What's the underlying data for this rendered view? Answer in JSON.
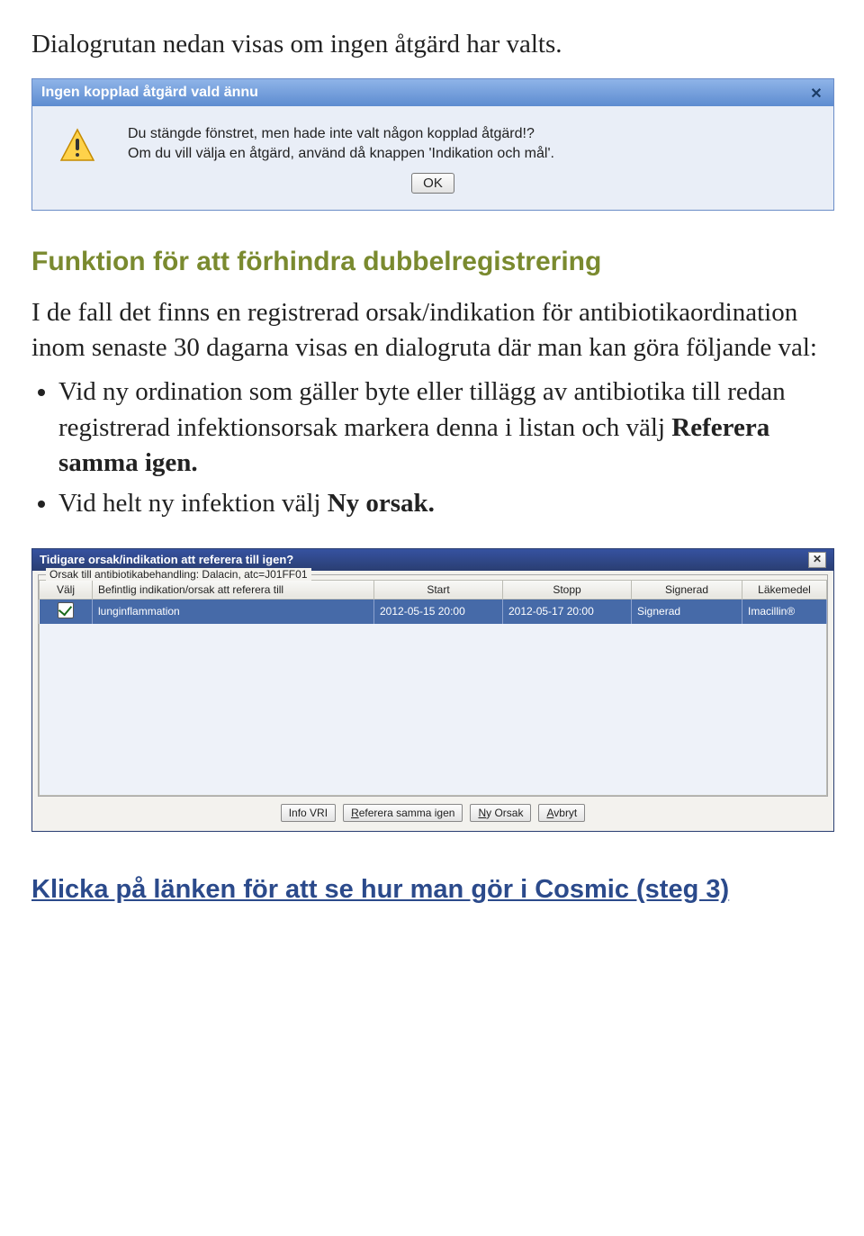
{
  "doc": {
    "intro": "Dialogrutan nedan visas om ingen åtgärd har valts.",
    "heading": "Funktion för att förhindra dubbelregistrering",
    "para": "I de fall det finns en registrerad orsak/indikation för antibiotikaordination inom senaste 30 dagarna visas en dialogruta där man kan göra följande val:",
    "li1_a": "Vid ny ordination som gäller byte eller tillägg av antibiotika till redan registrerad infektionsorsak markera denna i listan och välj ",
    "li1_b": "Referera samma igen.",
    "li2_a": "Vid helt ny infektion välj ",
    "li2_b": "Ny orsak.",
    "link": "Klicka på länken för att se hur man gör i Cosmic (steg 3)"
  },
  "dlg1": {
    "title": "Ingen kopplad åtgärd vald ännu",
    "line1": "Du stängde fönstret, men hade inte valt någon kopplad åtgärd!?",
    "line2": "Om du vill välja en åtgärd, använd då knappen 'Indikation och mål'.",
    "ok": "OK"
  },
  "dlg2": {
    "title": "Tidigare orsak/indikation att referera till igen?",
    "legend": "Orsak till antibiotikabehandling: Dalacin, atc=J01FF01",
    "headers": {
      "valj": "Välj",
      "indik": "Befintlig indikation/orsak att referera till",
      "start": "Start",
      "stopp": "Stopp",
      "sign": "Signerad",
      "lak": "Läkemedel"
    },
    "row": {
      "indik": "lunginflammation",
      "start": "2012-05-15 20:00",
      "stopp": "2012-05-17 20:00",
      "sign": "Signerad",
      "lak": "Imacillin®"
    },
    "buttons": {
      "info": "Info VRI",
      "ref_pre": "R",
      "ref_rest": "eferera samma igen",
      "ny_pre": "N",
      "ny_rest": "y Orsak",
      "av_pre": "A",
      "av_rest": "vbryt"
    }
  }
}
